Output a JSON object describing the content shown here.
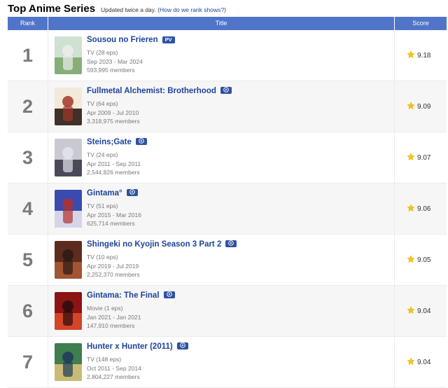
{
  "header": {
    "title": "Top Anime Series",
    "subtitle": "Updated twice a day.",
    "help_link": "(How do we rank shows?)"
  },
  "table": {
    "columns": {
      "rank": "Rank",
      "title": "Title",
      "score": "Score"
    },
    "rows": [
      {
        "rank": "1",
        "title": "Sousou no Frieren",
        "badge": "PV",
        "type": "TV (28 eps)",
        "aired": "Sep 2023 - Mar 2024",
        "members": "593,995 members",
        "score": "9.18",
        "thumb_colors": [
          "#cfe1d2",
          "#7ea86c",
          "#ececec"
        ]
      },
      {
        "rank": "2",
        "title": "Fullmetal Alchemist: Brotherhood",
        "badge": "play",
        "type": "TV (64 eps)",
        "aired": "Apr 2009 - Jul 2010",
        "members": "3,318,975 members",
        "score": "9.09",
        "thumb_colors": [
          "#f2e9d8",
          "#2d1c12",
          "#a3362a"
        ]
      },
      {
        "rank": "3",
        "title": "Steins;Gate",
        "badge": "play",
        "type": "TV (24 eps)",
        "aired": "Apr 2011 - Sep 2011",
        "members": "2,544,826 members",
        "score": "9.07",
        "thumb_colors": [
          "#c9c9d1",
          "#3b3b4c",
          "#e4e4ec"
        ]
      },
      {
        "rank": "4",
        "title": "Gintama°",
        "badge": "play",
        "type": "TV (51 eps)",
        "aired": "Apr 2015 - Mar 2016",
        "members": "625,714 members",
        "score": "9.06",
        "thumb_colors": [
          "#3a4bb0",
          "#e8e4ee",
          "#b23030"
        ]
      },
      {
        "rank": "5",
        "title": "Shingeki no Kyojin Season 3 Part 2",
        "badge": "play",
        "type": "TV (10 eps)",
        "aired": "Apr 2019 - Jul 2019",
        "members": "2,252,370 members",
        "score": "9.05",
        "thumb_colors": [
          "#5c2c1e",
          "#a85a32",
          "#2c1a14"
        ]
      },
      {
        "rank": "6",
        "title": "Gintama: The Final",
        "badge": "play",
        "type": "Movie (1 eps)",
        "aired": "Jan 2021 - Jan 2021",
        "members": "147,910 members",
        "score": "9.04",
        "thumb_colors": [
          "#8c1414",
          "#d94a2a",
          "#2a0c0c"
        ]
      },
      {
        "rank": "7",
        "title": "Hunter x Hunter (2011)",
        "badge": "play",
        "type": "TV (148 eps)",
        "aired": "Oct 2011 - Sep 2014",
        "members": "2,804,227 members",
        "score": "9.04",
        "thumb_colors": [
          "#3f7e4e",
          "#d8c27a",
          "#1e3a5a"
        ]
      }
    ]
  },
  "colors": {
    "header_bar": "#4f74c8",
    "title_link": "#1c439b",
    "badge": "#2e51a2",
    "star": "#f5c518"
  }
}
